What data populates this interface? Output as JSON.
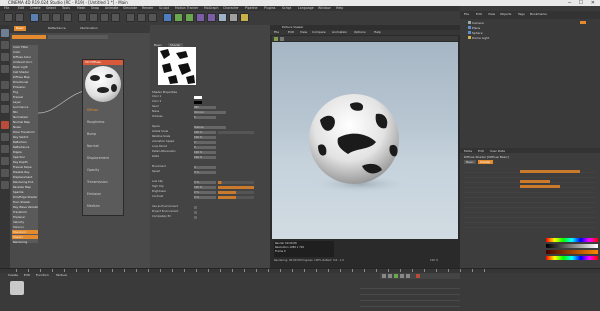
{
  "app": {
    "title": "CINEMA 4D R19.024 Studio (RC - R19) - [Untitled 1 *] - Main",
    "window_controls": "─ ☐ ✕"
  },
  "main_menu": [
    "File",
    "Edit",
    "Create",
    "Select",
    "Tools",
    "Mesh",
    "Snap",
    "Animate",
    "Simulate",
    "Render",
    "Sculpt",
    "Motion Tracker",
    "MoGraph",
    "Character",
    "Pipeline",
    "Plugins",
    "Script",
    "Language",
    "Window",
    "Help"
  ],
  "layout_label": "Layout:",
  "layout_value": "Startup (User)",
  "node_editor": {
    "tabs": [
      "Basic",
      "Reflectance",
      "Illumination"
    ],
    "sidebar": [
      "Color Filter",
      "Color",
      "Diffuse Color",
      "Ambient Occl.",
      "Back Light",
      "Cell Shader",
      "Diffuse Map",
      "Directional",
      "Emission",
      "Fog",
      "Fresnel",
      "Layer",
      "Luminance",
      "Mix",
      "Normalizer",
      "Normal Map",
      "Noise",
      "Polar Transform",
      "Ray Switch",
      "Reflection",
      "Reflectance",
      "Ripple",
      "Spectral",
      "Ray Depth",
      "Fresnel Slope",
      "Disable Ray",
      "Displacement",
      "Rendering Ent.",
      "Parallax Map",
      "Sparkle",
      "Rim/Edge Shader",
      "Toon Shader",
      "Ray Wave Variation",
      "Transform",
      "Triplanar",
      "Velocity",
      "Voronoi",
      "Standard",
      "Shader",
      "Rendering"
    ],
    "node": {
      "title": "CD Diffuse",
      "ports": [
        "Diffuse",
        "Roughness",
        "Bump",
        "Normal",
        "Displacement",
        "Opacity",
        "Transmission",
        "Emission",
        "Medium"
      ]
    }
  },
  "attributes": {
    "tabs": [
      "Basic",
      "Shader"
    ],
    "section_title": "Shader Properties",
    "rows": [
      {
        "label": "Color 1",
        "value": ""
      },
      {
        "label": "Color 2",
        "value": ""
      },
      {
        "label": "Seed",
        "value": "665"
      },
      {
        "label": "Noise",
        "value": "Voronoi"
      },
      {
        "label": "Octaves",
        "value": "5"
      },
      {
        "label": "Space",
        "value": "Texture"
      },
      {
        "label": "Global Scale",
        "value": "100 %"
      },
      {
        "label": "Relative Scale",
        "value": "100 %"
      },
      {
        "label": "Animation Speed",
        "value": "0"
      },
      {
        "label": "Loop Period",
        "value": "0"
      },
      {
        "label": "Detail Attenuation",
        "value": "100 %"
      },
      {
        "label": "Delta",
        "value": "100 %"
      },
      {
        "label": "Movement",
        "value": "0"
      },
      {
        "label": "Speed",
        "value": "0 %"
      },
      {
        "label": "Low Clip",
        "value": "0 %"
      },
      {
        "label": "High Clip",
        "value": "100 %"
      },
      {
        "label": "Brightness",
        "value": "0 %"
      },
      {
        "label": "Contrast",
        "value": "0 %"
      },
      {
        "label": "Use as Environment",
        "value": ""
      },
      {
        "label": "Project Environment",
        "value": ""
      },
      {
        "label": "Completely fill",
        "value": ""
      }
    ]
  },
  "picture_viewer": {
    "title": "Picture Viewer",
    "menu": [
      "File",
      "Edit",
      "View",
      "Compare",
      "Animation",
      "Options",
      "Help"
    ],
    "status": [
      "Render 00:00:08",
      "Resolution 1280 x 720",
      "Frame 0"
    ],
    "footer": "Rendering: 00:00:08  Progress: 100%  Reflect: 0.8 - 1.0",
    "percent": "100 %"
  },
  "object_manager": {
    "menu": [
      "File",
      "Edit",
      "View",
      "Objects",
      "Tags",
      "Bookmarks"
    ],
    "objects": [
      "Camera",
      "Plane",
      "Sphere",
      "Dome Light"
    ]
  },
  "attribute_manager": {
    "menu": [
      "Mode",
      "Edit",
      "User Data"
    ],
    "title": "Diffuse Shader [Diffuse Basic]",
    "tabs": [
      "Basic",
      "Shader"
    ]
  },
  "material_manager": {
    "menu": [
      "Create",
      "Edit",
      "Function",
      "Texture"
    ]
  },
  "colors": {
    "node_header": "#d85a3a",
    "accent_orange": "#e38b2e",
    "render_bg_top": "#a7b6c4",
    "render_bg_bottom": "#d1dbe2"
  }
}
